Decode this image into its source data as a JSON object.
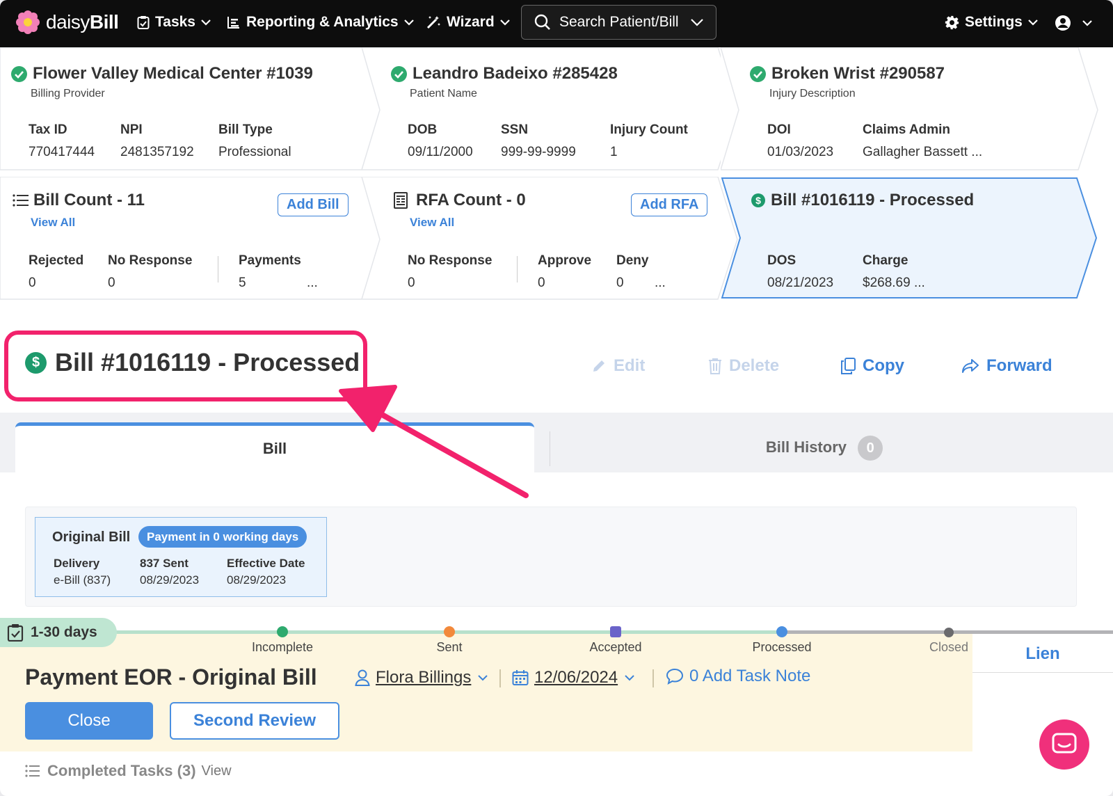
{
  "nav": {
    "logo_text_a": "daisy",
    "logo_text_b": "Bill",
    "tasks": "Tasks",
    "reporting": "Reporting & Analytics",
    "wizard": "Wizard",
    "search_placeholder": "Search Patient/Bill",
    "settings": "Settings"
  },
  "provider": {
    "title": "Flower Valley Medical Center #1039",
    "subtitle": "Billing Provider",
    "fields": [
      {
        "label": "Tax ID",
        "value": "770417444"
      },
      {
        "label": "NPI",
        "value": "2481357192"
      },
      {
        "label": "Bill Type",
        "value": "Professional"
      }
    ]
  },
  "patient": {
    "title": "Leandro Badeixo #285428",
    "subtitle": "Patient Name",
    "fields": [
      {
        "label": "DOB",
        "value": "09/11/2000"
      },
      {
        "label": "SSN",
        "value": "999-99-9999"
      },
      {
        "label": "Injury Count",
        "value": "1"
      }
    ]
  },
  "injury": {
    "title": "Broken Wrist #290587",
    "subtitle": "Injury Description",
    "fields": [
      {
        "label": "DOI",
        "value": "01/03/2023"
      },
      {
        "label": "Claims Admin",
        "value": "Gallagher Bassett ..."
      }
    ]
  },
  "bill_count": {
    "title": "Bill Count - 11",
    "add_button": "Add Bill",
    "view_all": "View All",
    "fields": [
      {
        "label": "Rejected",
        "value": "0"
      },
      {
        "label": "No Response",
        "value": "0"
      },
      {
        "label": "Payments",
        "value": "5"
      }
    ],
    "more": "..."
  },
  "rfa_count": {
    "title": "RFA Count - 0",
    "add_button": "Add RFA",
    "view_all": "View All",
    "fields": [
      {
        "label": "No Response",
        "value": "0"
      },
      {
        "label": "Approve",
        "value": "0"
      },
      {
        "label": "Deny",
        "value": "0"
      }
    ],
    "more": "..."
  },
  "bill_card": {
    "title": "Bill #1016119 - Processed",
    "fields": [
      {
        "label": "DOS",
        "value": "08/21/2023"
      },
      {
        "label": "Charge",
        "value": "$268.69 ..."
      }
    ]
  },
  "header": {
    "title": "Bill #1016119 - Processed",
    "dollar": "$",
    "actions": {
      "edit": "Edit",
      "delete": "Delete",
      "copy": "Copy",
      "forward": "Forward"
    }
  },
  "tabs": {
    "bill": "Bill",
    "history": "Bill History",
    "history_count": "0"
  },
  "original_bill": {
    "title": "Original Bill",
    "pill": "Payment in 0 working days",
    "fields": [
      {
        "label": "Delivery",
        "value": "e-Bill (837)"
      },
      {
        "label": "837 Sent",
        "value": "08/29/2023"
      },
      {
        "label": "Effective Date",
        "value": "08/29/2023"
      }
    ]
  },
  "task": {
    "days": "1-30 days",
    "steps": [
      "Incomplete",
      "Sent",
      "Accepted",
      "Processed",
      "Closed"
    ],
    "title": "Payment EOR - Original Bill",
    "assignee": "Flora Billings",
    "due_date": "12/06/2024",
    "note": "0 Add Task Note",
    "close_button": "Close",
    "review_button": "Second Review",
    "lien": "Lien"
  },
  "completed": {
    "label": "Completed Tasks (3)",
    "view": "View"
  },
  "colors": {
    "accent": "#3b82d8",
    "highlight": "#f2226c",
    "success": "#2eaa6e",
    "task_bg": "#fdf6e0"
  }
}
